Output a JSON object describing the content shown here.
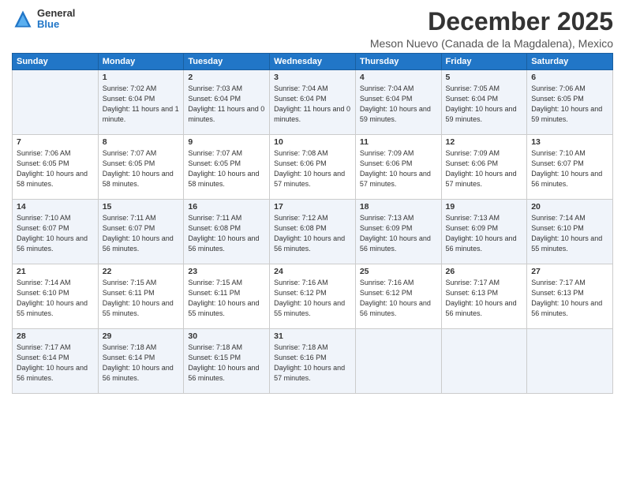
{
  "logo": {
    "general": "General",
    "blue": "Blue"
  },
  "title": "December 2025",
  "subtitle": "Meson Nuevo (Canada de la Magdalena), Mexico",
  "headers": [
    "Sunday",
    "Monday",
    "Tuesday",
    "Wednesday",
    "Thursday",
    "Friday",
    "Saturday"
  ],
  "weeks": [
    [
      {
        "day": "",
        "sunrise": "",
        "sunset": "",
        "daylight": ""
      },
      {
        "day": "1",
        "sunrise": "Sunrise: 7:02 AM",
        "sunset": "Sunset: 6:04 PM",
        "daylight": "Daylight: 11 hours and 1 minute."
      },
      {
        "day": "2",
        "sunrise": "Sunrise: 7:03 AM",
        "sunset": "Sunset: 6:04 PM",
        "daylight": "Daylight: 11 hours and 0 minutes."
      },
      {
        "day": "3",
        "sunrise": "Sunrise: 7:04 AM",
        "sunset": "Sunset: 6:04 PM",
        "daylight": "Daylight: 11 hours and 0 minutes."
      },
      {
        "day": "4",
        "sunrise": "Sunrise: 7:04 AM",
        "sunset": "Sunset: 6:04 PM",
        "daylight": "Daylight: 10 hours and 59 minutes."
      },
      {
        "day": "5",
        "sunrise": "Sunrise: 7:05 AM",
        "sunset": "Sunset: 6:04 PM",
        "daylight": "Daylight: 10 hours and 59 minutes."
      },
      {
        "day": "6",
        "sunrise": "Sunrise: 7:06 AM",
        "sunset": "Sunset: 6:05 PM",
        "daylight": "Daylight: 10 hours and 59 minutes."
      }
    ],
    [
      {
        "day": "7",
        "sunrise": "Sunrise: 7:06 AM",
        "sunset": "Sunset: 6:05 PM",
        "daylight": "Daylight: 10 hours and 58 minutes."
      },
      {
        "day": "8",
        "sunrise": "Sunrise: 7:07 AM",
        "sunset": "Sunset: 6:05 PM",
        "daylight": "Daylight: 10 hours and 58 minutes."
      },
      {
        "day": "9",
        "sunrise": "Sunrise: 7:07 AM",
        "sunset": "Sunset: 6:05 PM",
        "daylight": "Daylight: 10 hours and 58 minutes."
      },
      {
        "day": "10",
        "sunrise": "Sunrise: 7:08 AM",
        "sunset": "Sunset: 6:06 PM",
        "daylight": "Daylight: 10 hours and 57 minutes."
      },
      {
        "day": "11",
        "sunrise": "Sunrise: 7:09 AM",
        "sunset": "Sunset: 6:06 PM",
        "daylight": "Daylight: 10 hours and 57 minutes."
      },
      {
        "day": "12",
        "sunrise": "Sunrise: 7:09 AM",
        "sunset": "Sunset: 6:06 PM",
        "daylight": "Daylight: 10 hours and 57 minutes."
      },
      {
        "day": "13",
        "sunrise": "Sunrise: 7:10 AM",
        "sunset": "Sunset: 6:07 PM",
        "daylight": "Daylight: 10 hours and 56 minutes."
      }
    ],
    [
      {
        "day": "14",
        "sunrise": "Sunrise: 7:10 AM",
        "sunset": "Sunset: 6:07 PM",
        "daylight": "Daylight: 10 hours and 56 minutes."
      },
      {
        "day": "15",
        "sunrise": "Sunrise: 7:11 AM",
        "sunset": "Sunset: 6:07 PM",
        "daylight": "Daylight: 10 hours and 56 minutes."
      },
      {
        "day": "16",
        "sunrise": "Sunrise: 7:11 AM",
        "sunset": "Sunset: 6:08 PM",
        "daylight": "Daylight: 10 hours and 56 minutes."
      },
      {
        "day": "17",
        "sunrise": "Sunrise: 7:12 AM",
        "sunset": "Sunset: 6:08 PM",
        "daylight": "Daylight: 10 hours and 56 minutes."
      },
      {
        "day": "18",
        "sunrise": "Sunrise: 7:13 AM",
        "sunset": "Sunset: 6:09 PM",
        "daylight": "Daylight: 10 hours and 56 minutes."
      },
      {
        "day": "19",
        "sunrise": "Sunrise: 7:13 AM",
        "sunset": "Sunset: 6:09 PM",
        "daylight": "Daylight: 10 hours and 56 minutes."
      },
      {
        "day": "20",
        "sunrise": "Sunrise: 7:14 AM",
        "sunset": "Sunset: 6:10 PM",
        "daylight": "Daylight: 10 hours and 55 minutes."
      }
    ],
    [
      {
        "day": "21",
        "sunrise": "Sunrise: 7:14 AM",
        "sunset": "Sunset: 6:10 PM",
        "daylight": "Daylight: 10 hours and 55 minutes."
      },
      {
        "day": "22",
        "sunrise": "Sunrise: 7:15 AM",
        "sunset": "Sunset: 6:11 PM",
        "daylight": "Daylight: 10 hours and 55 minutes."
      },
      {
        "day": "23",
        "sunrise": "Sunrise: 7:15 AM",
        "sunset": "Sunset: 6:11 PM",
        "daylight": "Daylight: 10 hours and 55 minutes."
      },
      {
        "day": "24",
        "sunrise": "Sunrise: 7:16 AM",
        "sunset": "Sunset: 6:12 PM",
        "daylight": "Daylight: 10 hours and 55 minutes."
      },
      {
        "day": "25",
        "sunrise": "Sunrise: 7:16 AM",
        "sunset": "Sunset: 6:12 PM",
        "daylight": "Daylight: 10 hours and 56 minutes."
      },
      {
        "day": "26",
        "sunrise": "Sunrise: 7:17 AM",
        "sunset": "Sunset: 6:13 PM",
        "daylight": "Daylight: 10 hours and 56 minutes."
      },
      {
        "day": "27",
        "sunrise": "Sunrise: 7:17 AM",
        "sunset": "Sunset: 6:13 PM",
        "daylight": "Daylight: 10 hours and 56 minutes."
      }
    ],
    [
      {
        "day": "28",
        "sunrise": "Sunrise: 7:17 AM",
        "sunset": "Sunset: 6:14 PM",
        "daylight": "Daylight: 10 hours and 56 minutes."
      },
      {
        "day": "29",
        "sunrise": "Sunrise: 7:18 AM",
        "sunset": "Sunset: 6:14 PM",
        "daylight": "Daylight: 10 hours and 56 minutes."
      },
      {
        "day": "30",
        "sunrise": "Sunrise: 7:18 AM",
        "sunset": "Sunset: 6:15 PM",
        "daylight": "Daylight: 10 hours and 56 minutes."
      },
      {
        "day": "31",
        "sunrise": "Sunrise: 7:18 AM",
        "sunset": "Sunset: 6:16 PM",
        "daylight": "Daylight: 10 hours and 57 minutes."
      },
      {
        "day": "",
        "sunrise": "",
        "sunset": "",
        "daylight": ""
      },
      {
        "day": "",
        "sunrise": "",
        "sunset": "",
        "daylight": ""
      },
      {
        "day": "",
        "sunrise": "",
        "sunset": "",
        "daylight": ""
      }
    ]
  ]
}
